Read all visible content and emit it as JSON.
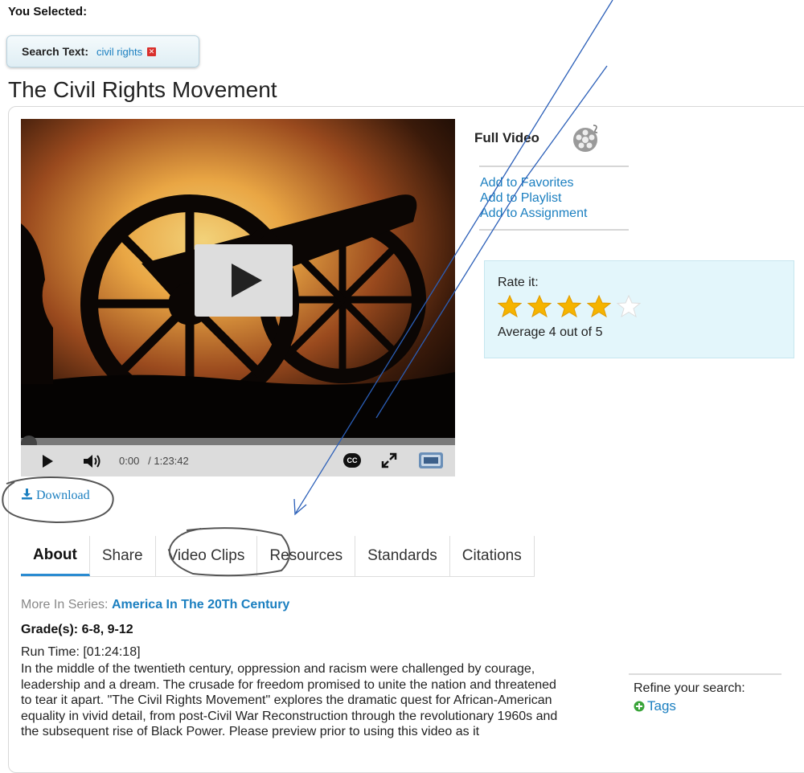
{
  "selection": {
    "heading": "You Selected:",
    "filter_label": "Search Text:",
    "filter_value": "civil rights",
    "remove_glyph": "✕"
  },
  "page_title": "The Civil Rights Movement",
  "player": {
    "time_current": "0:00",
    "time_total": "/ 1:23:42",
    "cc_label": "CC",
    "progress_fraction": 0.0
  },
  "side": {
    "full_video_label": "Full Video",
    "links": [
      "Add to Favorites",
      "Add to Playlist",
      "Add to Assignment"
    ]
  },
  "rating": {
    "label": "Rate it:",
    "value": 4,
    "max": 5,
    "average_text": "Average 4 out of 5"
  },
  "download_label": "Download",
  "tabs": [
    "About",
    "Share",
    "Video Clips",
    "Resources",
    "Standards",
    "Citations"
  ],
  "active_tab": "About",
  "about": {
    "series_prefix": "More In Series:",
    "series_name": "America In The 20Th Century",
    "grades": "Grade(s): 6-8, 9-12",
    "runtime": "Run Time: [01:24:18]",
    "description": "In the middle of the twentieth century, oppression and racism were challenged by courage, leadership and a dream. The crusade for freedom promised to unite the nation and threatened to tear it apart. \"The Civil Rights Movement\" explores the dramatic quest for African-American equality in vivid detail, from post-Civil War Reconstruction through the revolutionary 1960s and the subsequent rise of Black Power. Please preview prior to using this video as it"
  },
  "refine": {
    "label": "Refine your search:",
    "tags_label": "Tags"
  },
  "colors": {
    "link": "#1b7fc0",
    "tab_underline": "#2a8bd1",
    "rating_bg": "#e3f6fb",
    "star": "#f5b400",
    "annotation": "#2b5fb8"
  },
  "icons": [
    "remove-filter-icon",
    "film-reel-icon",
    "star-icon",
    "download-icon",
    "play-icon",
    "volume-icon",
    "closed-captions-icon",
    "fullscreen-icon",
    "logo-badge-icon",
    "add-tag-icon"
  ]
}
